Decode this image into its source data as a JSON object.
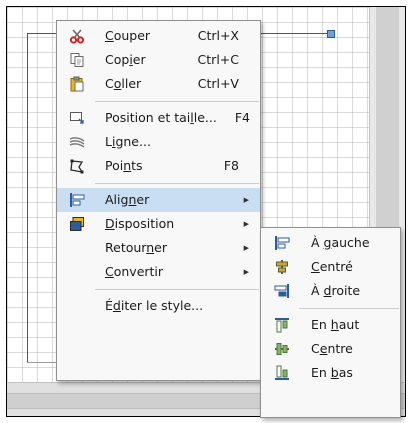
{
  "colors": {
    "menu_bg": "#f8f8f8",
    "highlight": "#c9ddf3",
    "accent_blue": "#2b5d9a",
    "scissors_red": "#d42020",
    "paste_yellow": "#e8b820"
  },
  "context_menu": {
    "items": [
      {
        "label_pre": "",
        "label_key": "C",
        "label_post": "ouper",
        "accel": "Ctrl+X",
        "icon": "scissors-icon"
      },
      {
        "label_pre": "Cop",
        "label_key": "i",
        "label_post": "er",
        "accel": "Ctrl+C",
        "icon": "copy-icon"
      },
      {
        "label_pre": "C",
        "label_key": "o",
        "label_post": "ller",
        "accel": "Ctrl+V",
        "icon": "paste-icon"
      },
      {
        "label_pre": "Position et tai",
        "label_key": "l",
        "label_post": "le...",
        "accel": "F4",
        "icon": "position-size-icon"
      },
      {
        "label_pre": "L",
        "label_key": "i",
        "label_post": "gne...",
        "accel": "",
        "icon": "line-icon"
      },
      {
        "label_pre": "Poi",
        "label_key": "n",
        "label_post": "ts",
        "accel": "F8",
        "icon": "points-icon"
      },
      {
        "label_pre": "Alig",
        "label_key": "n",
        "label_post": "er",
        "arrow": "▶",
        "icon": "align-icon"
      },
      {
        "label_pre": "",
        "label_key": "D",
        "label_post": "isposition",
        "arrow": "▶",
        "icon": "arrange-icon"
      },
      {
        "label_pre": "Retour",
        "label_key": "n",
        "label_post": "er",
        "arrow": "▶"
      },
      {
        "label_pre": "",
        "label_key": "C",
        "label_post": "onvertir",
        "arrow": "▶"
      },
      {
        "label_pre": "É",
        "label_key": "d",
        "label_post": "iter le style..."
      }
    ]
  },
  "align_submenu": {
    "items": [
      {
        "label_pre": "À ",
        "label_key": "g",
        "label_post": "auche",
        "icon": "align-left-icon"
      },
      {
        "label_pre": "",
        "label_key": "C",
        "label_post": "entré",
        "icon": "align-center-icon"
      },
      {
        "label_pre": "À ",
        "label_key": "d",
        "label_post": "roite",
        "icon": "align-right-icon"
      },
      {
        "label_pre": "En ",
        "label_key": "h",
        "label_post": "aut",
        "icon": "align-top-icon"
      },
      {
        "label_pre": "C",
        "label_key": "e",
        "label_post": "ntre",
        "icon": "align-middle-icon"
      },
      {
        "label_pre": "En ",
        "label_key": "b",
        "label_post": "as",
        "icon": "align-bottom-icon"
      }
    ]
  }
}
